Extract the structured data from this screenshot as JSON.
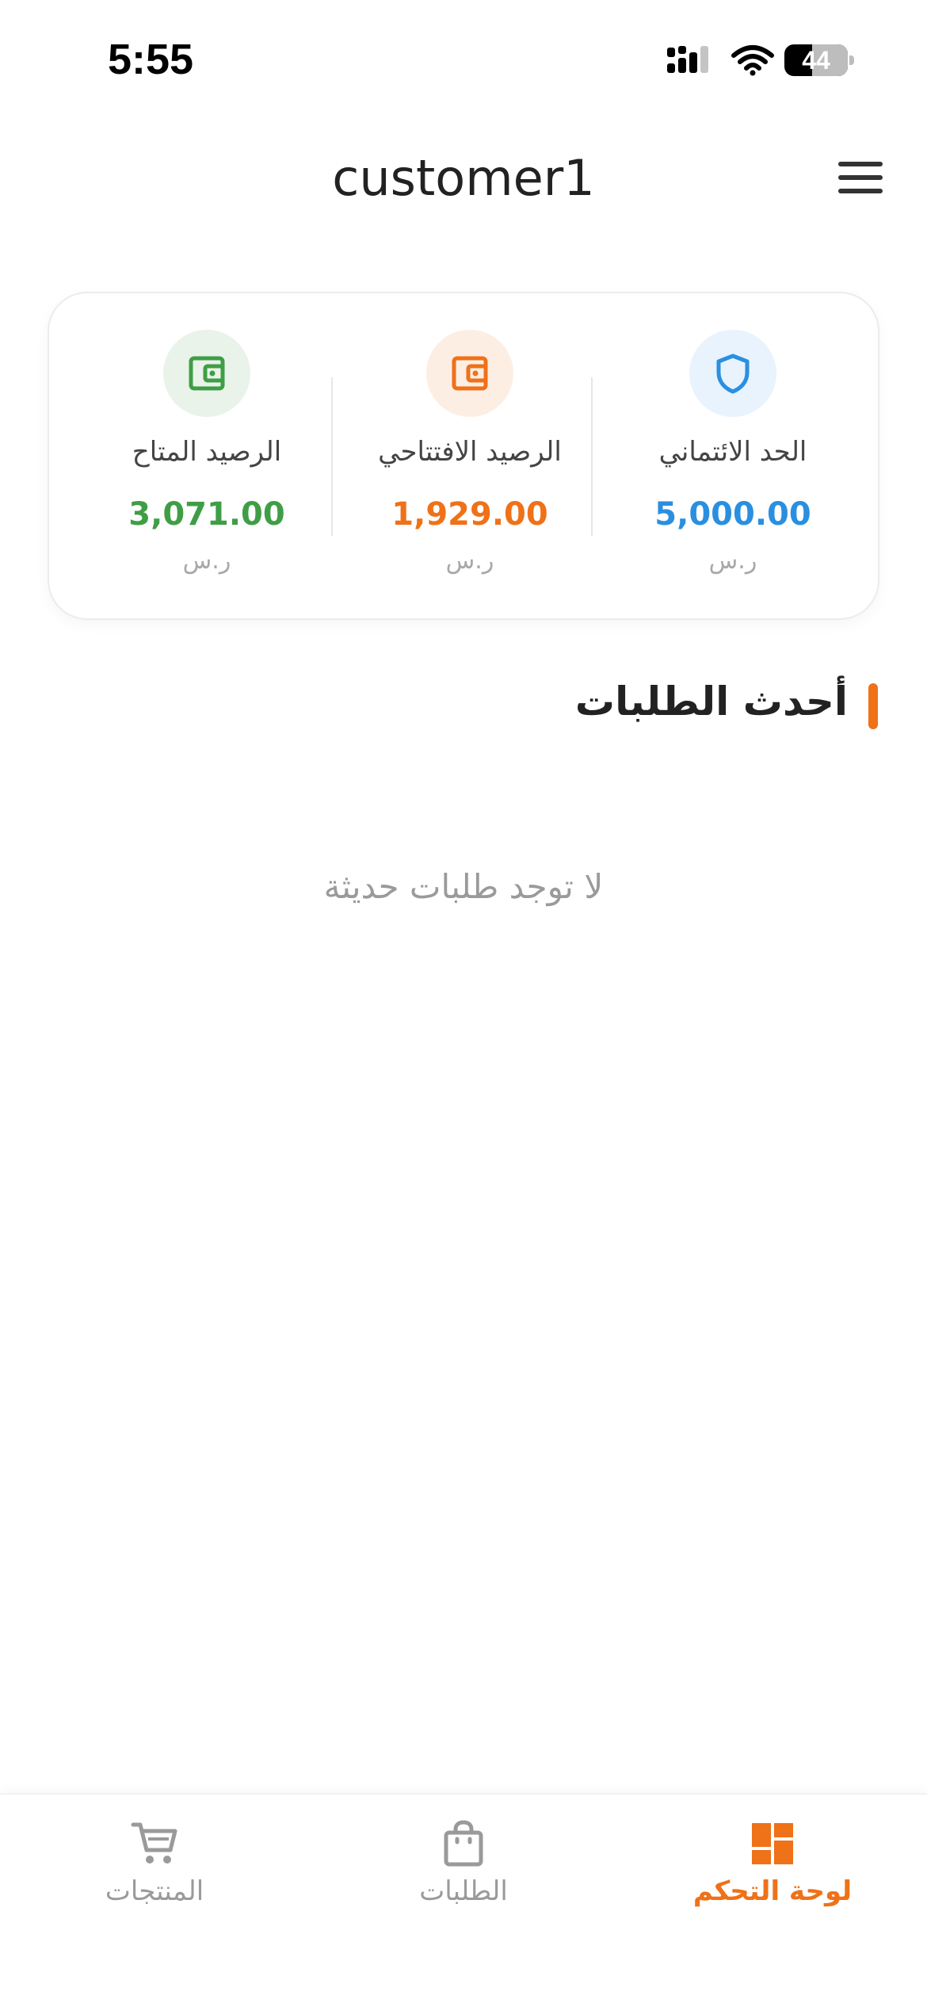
{
  "status_bar": {
    "time": "5:55",
    "battery_level": "44",
    "battery_percent": 44
  },
  "header": {
    "title": "customer1",
    "menu_icon": "hamburger-menu-icon"
  },
  "summary": {
    "items": [
      {
        "label": "الحد الائتماني",
        "value": "5,000.00",
        "currency": "ر.س",
        "icon": "shield-icon",
        "color": "#2a8fe0"
      },
      {
        "label": "الرصيد الافتتاحي",
        "value": "1,929.00",
        "currency": "ر.س",
        "icon": "wallet-icon",
        "color": "#ef7118"
      },
      {
        "label": "الرصيد المتاح",
        "value": "3,071.00",
        "currency": "ر.س",
        "icon": "wallet-icon",
        "color": "#3f9e45"
      }
    ]
  },
  "recent_orders": {
    "title": "أحدث الطلبات",
    "empty_text": "لا توجد طلبات حديثة"
  },
  "bottom_nav": {
    "items": [
      {
        "label": "لوحة التحكم",
        "icon": "dashboard-icon",
        "active": true
      },
      {
        "label": "الطلبات",
        "icon": "shopping-bag-icon",
        "active": false
      },
      {
        "label": "المنتجات",
        "icon": "cart-icon",
        "active": false
      }
    ]
  },
  "colors": {
    "accent": "#ef7118",
    "credit": "#2a8fe0",
    "available": "#3f9e45",
    "muted": "#9a9a9a"
  }
}
